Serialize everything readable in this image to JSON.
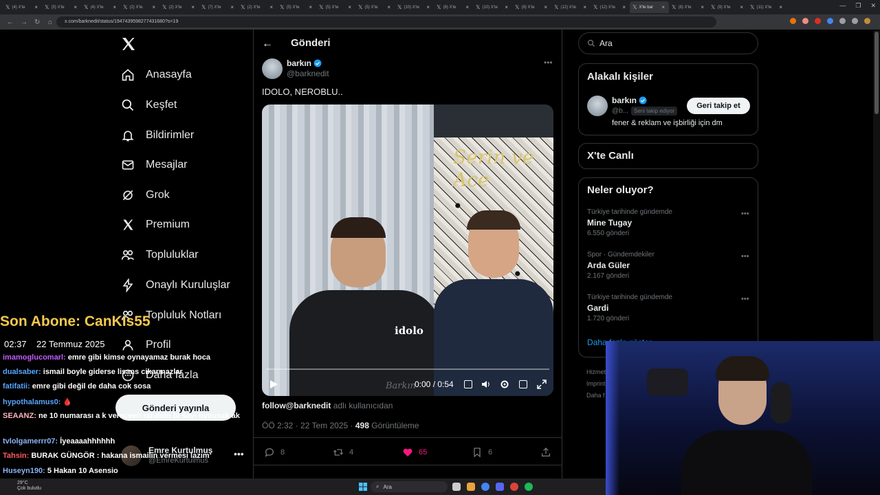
{
  "browser": {
    "tabs": [
      {
        "label": "(4) X'te"
      },
      {
        "label": "(5) X'te"
      },
      {
        "label": "(4) X'te"
      },
      {
        "label": "(2) X'te"
      },
      {
        "label": "(2) X'te"
      },
      {
        "label": "(7) X'te"
      },
      {
        "label": "(2) X'te"
      },
      {
        "label": "(5) X'te"
      },
      {
        "label": "(5) X'te"
      },
      {
        "label": "(5) X'te"
      },
      {
        "label": "(10) X'te"
      },
      {
        "label": "(8) X'te"
      },
      {
        "label": "(10) X'te"
      },
      {
        "label": "(9) X'te"
      },
      {
        "label": "(12) X'te"
      },
      {
        "label": "(12) X'te"
      },
      {
        "label": "X'te bar"
      },
      {
        "label": "(8) X'te"
      },
      {
        "label": "(9) X'te"
      },
      {
        "label": "(11) X'te"
      }
    ],
    "url": "x.com/barknedit/status/1947439598277431680?s=19"
  },
  "sidebar": {
    "items": [
      {
        "label": "Anasayfa",
        "icon": "home-icon"
      },
      {
        "label": "Keşfet",
        "icon": "search-icon"
      },
      {
        "label": "Bildirimler",
        "icon": "bell-icon"
      },
      {
        "label": "Mesajlar",
        "icon": "envelope-icon"
      },
      {
        "label": "Grok",
        "icon": "grok-icon"
      },
      {
        "label": "Premium",
        "icon": "x-logo-icon"
      },
      {
        "label": "Topluluklar",
        "icon": "people-icon"
      },
      {
        "label": "Onaylı Kuruluşlar",
        "icon": "lightning-icon"
      },
      {
        "label": "Topluluk Notları",
        "icon": "notes-icon"
      },
      {
        "label": "Profil",
        "icon": "person-icon"
      },
      {
        "label": "Daha fazla",
        "icon": "more-circle-icon"
      }
    ],
    "post_button": "Gönderi yayınla",
    "account": {
      "name": "Emre Kurtulmuş",
      "handle": "@EmreKurtulmus"
    }
  },
  "post": {
    "header_title": "Gönderi",
    "author_name": "barkın",
    "author_handle": "@barknedit",
    "text": "IDOLO, NEROBLU..",
    "video": {
      "caption": "idolo",
      "watermark": "Barkın",
      "neon_sign": "Serin ve Ace",
      "time": "0:00 / 0:54",
      "progress": 0
    },
    "from_user": {
      "handle": "follow@barknedit",
      "suffix": "adlı kullanıcıdan"
    },
    "meta": {
      "time": "ÖÖ 2:32 · 22 Tem 2025 · ",
      "views": "498",
      "views_label": "Görüntüleme"
    },
    "actions": {
      "replies": "8",
      "reposts": "4",
      "likes": "65",
      "bookmarks": "6"
    }
  },
  "right": {
    "search_placeholder": "Ara",
    "related_title": "Alakalı kişiler",
    "related": {
      "name": "barkın",
      "handle": "@b...",
      "badge": "Seni takip ediyor",
      "button": "Geri takip et",
      "bio": "fener & reklam ve işbirliği için dm"
    },
    "live_title": "X'te Canlı",
    "trends_title": "Neler oluyor?",
    "trends": [
      {
        "context": "Türkiye tarihinde gündemde",
        "name": "Mine Tugay",
        "count": "6.550 gönderi"
      },
      {
        "context": "Spor · Gündemdekiler",
        "name": "Arda Güler",
        "count": "2.167 gönderi"
      },
      {
        "context": "Türkiye tarihinde gündemde",
        "name": "Gardi",
        "count": "1.720 gönderi"
      }
    ],
    "more_link": "Daha fazla göster",
    "footer": [
      "Hizmet",
      "Imprint",
      "Daha f"
    ]
  },
  "overlay": {
    "last_sub": "Son Abone: CanKIs55",
    "clock": "02:37",
    "date": "22 Temmuz 2025",
    "chat": [
      {
        "user": "imamoglucomarl:",
        "msg": "emre gibi kimse oynayamaz burak hoca",
        "color": "#c35cff"
      },
      {
        "user": "dualsaber:",
        "msg": "ismail boyle giderse lisans cikarmazlar",
        "color": "#58a6ff"
      },
      {
        "user": "fatifatii:",
        "msg": "emre gibi değil de daha cok sosa",
        "color": "#58a6ff"
      },
      {
        "user": "hypothalamus0:",
        "msg": "🩸",
        "color": "#58a6ff"
      },
      {
        "user": "SEAANZ:",
        "msg": "ne 10 numarası a k vereceen random bi sayı oynusak ak",
        "color": "#ffb3c1"
      },
      {
        "user": "tvlolgamerrr07:",
        "msg": "İyeaaaahhhhhh",
        "color": "#8ab4f8"
      },
      {
        "user": "Tahsin:",
        "msg": "BURAK GÜNGÖR : hakana ismailin vermesi lazım",
        "color": "#ff5c5c"
      },
      {
        "user": "Huseyn190:",
        "msg": "5 Hakan 10 Asensio",
        "color": "#8ab4f8"
      }
    ]
  },
  "taskbar": {
    "weather_temp": "29°C",
    "weather_desc": "Çok bulutlu",
    "search": "Ara"
  },
  "colors": {
    "accent": "#1d9bf0",
    "like": "#f91880",
    "overlay_title": "#f2c94c"
  }
}
